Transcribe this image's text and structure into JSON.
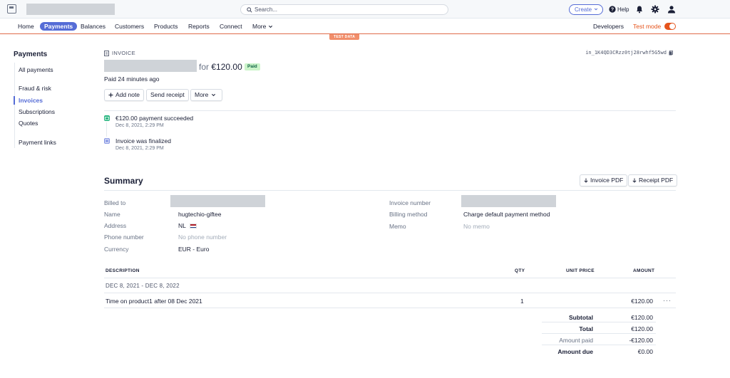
{
  "topbar": {
    "search_placeholder": "Search...",
    "create_label": "Create",
    "help_label": "Help"
  },
  "nav": {
    "items": [
      "Home",
      "Payments",
      "Balances",
      "Customers",
      "Products",
      "Reports",
      "Connect",
      "More"
    ],
    "active": "Payments",
    "developers": "Developers",
    "test_mode": "Test mode",
    "test_data_badge": "TEST DATA"
  },
  "sidebar": {
    "title": "Payments",
    "items": [
      "All payments",
      "Fraud & risk",
      "Invoices",
      "Subscriptions",
      "Quotes",
      "Payment links"
    ],
    "active": "Invoices"
  },
  "invoice": {
    "label": "INVOICE",
    "id": "in_1K4QD3CRzz0tj28rwhf5G5wd",
    "for_word": "for",
    "amount": "€120.00",
    "status": "Paid",
    "paid_ago": "Paid 24 minutes ago",
    "buttons": {
      "add_note": "Add note",
      "send_receipt": "Send receipt",
      "more": "More"
    }
  },
  "timeline": [
    {
      "title": "€120.00 payment succeeded",
      "time": "Dec 8, 2021, 2:29 PM"
    },
    {
      "title": "Invoice was finalized",
      "time": "Dec 8, 2021, 2:29 PM"
    }
  ],
  "summary": {
    "title": "Summary",
    "invoice_pdf": "Invoice PDF",
    "receipt_pdf": "Receipt PDF",
    "left": [
      {
        "label": "Billed to",
        "value": ""
      },
      {
        "label": "Name",
        "value": "hugtechio-giftee"
      },
      {
        "label": "Address",
        "value": "NL"
      },
      {
        "label": "Phone number",
        "value": "No phone number"
      },
      {
        "label": "Currency",
        "value": "EUR - Euro"
      }
    ],
    "right": [
      {
        "label": "Invoice number",
        "value": ""
      },
      {
        "label": "Billing method",
        "value": "Charge default payment method"
      },
      {
        "label": "Memo",
        "value": "No memo"
      }
    ]
  },
  "line_items": {
    "headers": {
      "description": "DESCRIPTION",
      "qty": "QTY",
      "unit_price": "UNIT PRICE",
      "amount": "AMOUNT"
    },
    "period": "DEC 8, 2021 - DEC 8, 2022",
    "rows": [
      {
        "description": "Time on product1 after 08 Dec 2021",
        "qty": "1",
        "unit_price": "",
        "amount": "€120.00"
      }
    ],
    "totals": [
      {
        "label": "Subtotal",
        "value": "€120.00"
      },
      {
        "label": "Total",
        "value": "€120.00"
      },
      {
        "label": "Amount paid",
        "value": "-€120.00"
      },
      {
        "label": "Amount due",
        "value": "€0.00"
      }
    ]
  },
  "colors": {
    "brand": "#556cd6",
    "test_mode": "#e5541c",
    "paid_badge_bg": "#cbf4c9",
    "paid_badge_text": "#0e6245"
  }
}
